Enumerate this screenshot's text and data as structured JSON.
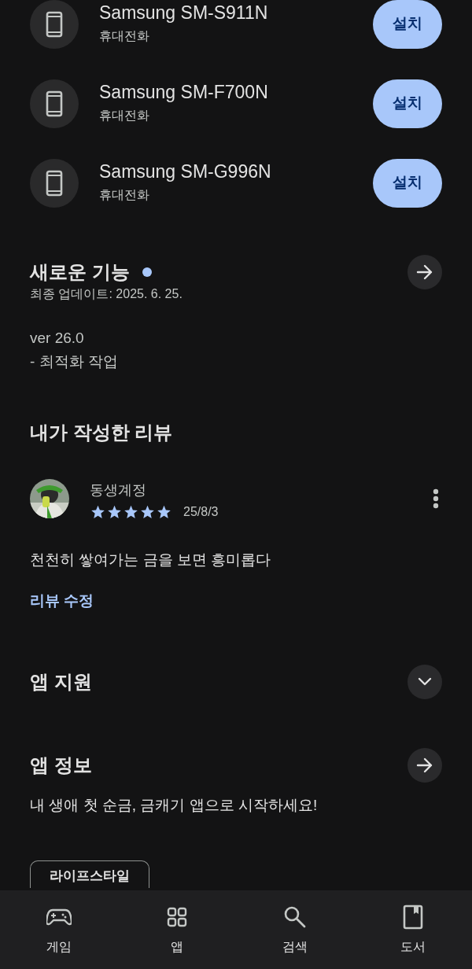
{
  "devices": [
    {
      "name": "Samsung SM-S911N",
      "type": "휴대전화",
      "button": "설치"
    },
    {
      "name": "Samsung SM-F700N",
      "type": "휴대전화",
      "button": "설치"
    },
    {
      "name": "Samsung SM-G996N",
      "type": "휴대전화",
      "button": "설치"
    }
  ],
  "whats_new": {
    "title": "새로운 기능",
    "new_dot": true,
    "updated": "최종 업데이트: 2025. 6. 25.",
    "lines": [
      "ver 26.0",
      "- 최적화 작업"
    ]
  },
  "my_review": {
    "title": "내가 작성한 리뷰",
    "author": "동생계정",
    "stars": 5,
    "date": "25/8/3",
    "text": "천천히 쌓여가는 금을 보면 흥미롭다",
    "edit_link": "리뷰 수정"
  },
  "app_support": {
    "title": "앱 지원",
    "expanded": false
  },
  "app_info": {
    "title": "앱 정보",
    "description": "내 생애 첫 순금, 금캐기 앱으로 시작하세요!",
    "category_chip": "라이프스타일"
  },
  "bottom_nav": [
    {
      "kind": "games",
      "label": "게임",
      "selected": false
    },
    {
      "kind": "apps",
      "label": "앱",
      "selected": false
    },
    {
      "kind": "search",
      "label": "검색",
      "selected": false
    },
    {
      "kind": "books",
      "label": "도서",
      "selected": false
    }
  ]
}
